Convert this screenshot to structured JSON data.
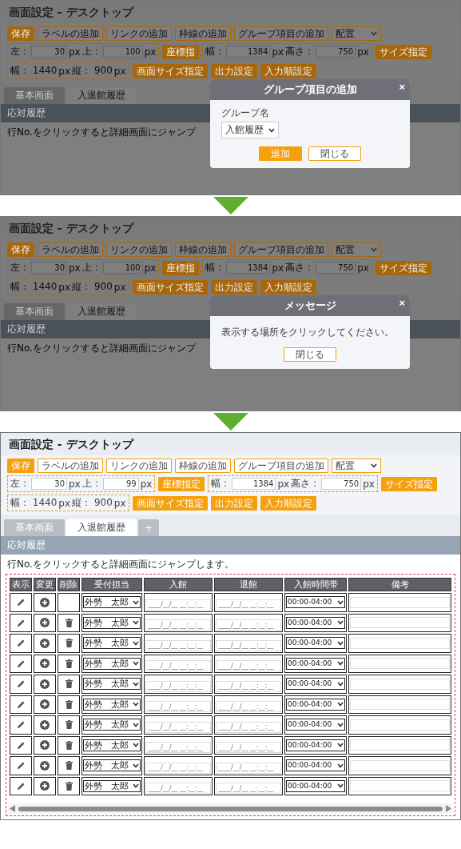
{
  "screens": [
    {
      "title": "画面設定 - デスクトップ",
      "toolbar": [
        {
          "kind": "filled",
          "label": "保存"
        },
        {
          "kind": "outline",
          "label": "ラベルの追加"
        },
        {
          "kind": "outline",
          "label": "リンクの追加"
        },
        {
          "kind": "outline",
          "label": "枠線の追加"
        },
        {
          "kind": "outline",
          "label": "グループ項目の追加"
        },
        {
          "kind": "select",
          "label": "配置"
        },
        {
          "kind": "fieldset",
          "parts": [
            {
              "kind": "text",
              "text": "左："
            },
            {
              "kind": "field",
              "text": "30"
            },
            {
              "kind": "text",
              "text": "px"
            },
            {
              "kind": "text",
              "text": "上："
            },
            {
              "kind": "field",
              "text": "100"
            },
            {
              "kind": "text",
              "text": "px"
            }
          ]
        },
        {
          "kind": "filled",
          "label": "座標指"
        },
        {
          "kind": "fieldset",
          "parts": [
            {
              "kind": "text",
              "text": "幅："
            },
            {
              "kind": "field",
              "text": "1384"
            },
            {
              "kind": "text",
              "text": "px"
            },
            {
              "kind": "text",
              "text": "高さ："
            },
            {
              "kind": "field",
              "text": "750"
            },
            {
              "kind": "text",
              "text": "px"
            }
          ]
        },
        {
          "kind": "filled",
          "label": "サイズ指定"
        },
        {
          "kind": "fieldset",
          "parts": [
            {
              "kind": "text",
              "text": "幅： 1440"
            },
            {
              "kind": "text",
              "text": "px"
            },
            {
              "kind": "text",
              "text": "縦： 900"
            },
            {
              "kind": "text",
              "text": "px"
            }
          ]
        },
        {
          "kind": "filled",
          "label": "画面サイズ指定"
        },
        {
          "kind": "filled",
          "label": "出力設定"
        },
        {
          "kind": "filled",
          "label": "入力順設定"
        }
      ],
      "tabs": [
        {
          "label": "基本画面",
          "selected": false
        },
        {
          "label": "入退館履歴",
          "selected": true
        }
      ],
      "section_title": "応対履歴",
      "hint": "行No.をクリックすると詳細画面にジャンプ",
      "dialog": {
        "title": "グループ項目の追加",
        "close": "×",
        "field_label": "グループ名",
        "select_value": "入館履歴",
        "buttons": [
          {
            "kind": "filled",
            "label": "追加"
          },
          {
            "kind": "outline",
            "label": "閉じる"
          }
        ]
      }
    },
    {
      "title": "画面設定 - デスクトップ",
      "toolbar": [
        {
          "kind": "filled",
          "label": "保存"
        },
        {
          "kind": "outline",
          "label": "ラベルの追加"
        },
        {
          "kind": "outline",
          "label": "リンクの追加"
        },
        {
          "kind": "outline",
          "label": "枠線の追加"
        },
        {
          "kind": "outline",
          "label": "グループ項目の追加"
        },
        {
          "kind": "select",
          "label": "配置"
        },
        {
          "kind": "fieldset",
          "parts": [
            {
              "kind": "text",
              "text": "左："
            },
            {
              "kind": "field",
              "text": "30"
            },
            {
              "kind": "text",
              "text": "px"
            },
            {
              "kind": "text",
              "text": "上："
            },
            {
              "kind": "field",
              "text": "100"
            },
            {
              "kind": "text",
              "text": "px"
            }
          ]
        },
        {
          "kind": "filled",
          "label": "座標指"
        },
        {
          "kind": "fieldset",
          "parts": [
            {
              "kind": "text",
              "text": "幅："
            },
            {
              "kind": "field",
              "text": "1384"
            },
            {
              "kind": "text",
              "text": "px"
            },
            {
              "kind": "text",
              "text": "高さ："
            },
            {
              "kind": "field",
              "text": "750"
            },
            {
              "kind": "text",
              "text": "px"
            }
          ]
        },
        {
          "kind": "filled",
          "label": "サイズ指定"
        },
        {
          "kind": "fieldset",
          "parts": [
            {
              "kind": "text",
              "text": "幅： 1440"
            },
            {
              "kind": "text",
              "text": "px"
            },
            {
              "kind": "text",
              "text": "縦： 900"
            },
            {
              "kind": "text",
              "text": "px"
            }
          ]
        },
        {
          "kind": "filled",
          "label": "画面サイズ指定"
        },
        {
          "kind": "filled",
          "label": "出力設定"
        },
        {
          "kind": "filled",
          "label": "入力順設定"
        }
      ],
      "tabs": [
        {
          "label": "基本画面",
          "selected": false
        },
        {
          "label": "入退館履歴",
          "selected": true
        }
      ],
      "section_title": "応対履歴",
      "hint": "行No.をクリックすると詳細画面にジャンプ",
      "dialog": {
        "title": "メッセージ",
        "close": "×",
        "message": "表示する場所をクリックしてください。",
        "buttons": [
          {
            "kind": "outline",
            "label": "閉じる"
          }
        ]
      }
    },
    {
      "title": "画面設定 - デスクトップ",
      "toolbar": [
        {
          "kind": "filled",
          "label": "保存"
        },
        {
          "kind": "outline",
          "label": "ラベルの追加"
        },
        {
          "kind": "outline",
          "label": "リンクの追加"
        },
        {
          "kind": "outline",
          "label": "枠線の追加"
        },
        {
          "kind": "outline",
          "label": "グループ項目の追加"
        },
        {
          "kind": "select",
          "label": "配置"
        },
        {
          "kind": "fieldset",
          "parts": [
            {
              "kind": "text",
              "text": "左："
            },
            {
              "kind": "field",
              "text": "30"
            },
            {
              "kind": "text",
              "text": "px"
            },
            {
              "kind": "text",
              "text": "上："
            },
            {
              "kind": "field",
              "text": "99"
            },
            {
              "kind": "text",
              "text": "px"
            }
          ]
        },
        {
          "kind": "filled",
          "label": "座標指定"
        },
        {
          "kind": "fieldset",
          "parts": [
            {
              "kind": "text",
              "text": "幅："
            },
            {
              "kind": "field",
              "text": "1384"
            },
            {
              "kind": "text",
              "text": "px"
            },
            {
              "kind": "text",
              "text": "高さ："
            },
            {
              "kind": "field",
              "text": "750"
            },
            {
              "kind": "text",
              "text": "px"
            }
          ]
        },
        {
          "kind": "filled",
          "label": "サイズ指定"
        },
        {
          "kind": "fieldset",
          "parts": [
            {
              "kind": "text",
              "text": "幅： 1440"
            },
            {
              "kind": "text",
              "text": "px"
            },
            {
              "kind": "text",
              "text": "縦： 900"
            },
            {
              "kind": "text",
              "text": "px"
            }
          ]
        },
        {
          "kind": "filled",
          "label": "画面サイズ指定"
        },
        {
          "kind": "filled",
          "label": "出力設定"
        },
        {
          "kind": "filled",
          "label": "入力順設定"
        }
      ],
      "tabs": [
        {
          "label": "基本画面",
          "selected": false
        },
        {
          "label": "入退館履歴",
          "selected": true
        }
      ],
      "add_tab": "+",
      "section_title": "応対履歴",
      "hint": "行No.をクリックすると詳細画面にジャンプします。",
      "table": {
        "columns": [
          "表示",
          "変更",
          "削除",
          "受付担当",
          "入館",
          "退館",
          "入館時間帯",
          "備考"
        ],
        "rows": [
          {
            "deletable": false,
            "staff": "外勢　太郎",
            "entry_placeholder": "____/__/__ __:__:__",
            "exit_placeholder": "____/__/__ __:__:__",
            "time_slot": "00:00-04:00"
          },
          {
            "deletable": true,
            "staff": "外勢　太郎",
            "entry_placeholder": "____/__/__ __:__:__",
            "exit_placeholder": "____/__/__ __:__:__",
            "time_slot": "00:00-04:00"
          },
          {
            "deletable": true,
            "staff": "外勢　太郎",
            "entry_placeholder": "____/__/__ __:__:__",
            "exit_placeholder": "____/__/__ __:__:__",
            "time_slot": "00:00-04:00"
          },
          {
            "deletable": true,
            "staff": "外勢　太郎",
            "entry_placeholder": "____/__/__ __:__:__",
            "exit_placeholder": "____/__/__ __:__:__",
            "time_slot": "00:00-04:00"
          },
          {
            "deletable": true,
            "staff": "外勢　太郎",
            "entry_placeholder": "____/__/__ __:__:__",
            "exit_placeholder": "____/__/__ __:__:__",
            "time_slot": "00:00-04:00"
          },
          {
            "deletable": true,
            "staff": "外勢　太郎",
            "entry_placeholder": "____/__/__ __:__:__",
            "exit_placeholder": "____/__/__ __:__:__",
            "time_slot": "00:00-04:00"
          },
          {
            "deletable": true,
            "staff": "外勢　太郎",
            "entry_placeholder": "____/__/__ __:__:__",
            "exit_placeholder": "____/__/__ __:__:__",
            "time_slot": "00:00-04:00"
          },
          {
            "deletable": true,
            "staff": "外勢　太郎",
            "entry_placeholder": "____/__/__ __:__:__",
            "exit_placeholder": "____/__/__ __:__:__",
            "time_slot": "00:00-04:00"
          },
          {
            "deletable": true,
            "staff": "外勢　太郎",
            "entry_placeholder": "____/__/__ __:__:__",
            "exit_placeholder": "____/__/__ __:__:__",
            "time_slot": "00:00-04:00"
          },
          {
            "deletable": true,
            "staff": "外勢　太郎",
            "entry_placeholder": "____/__/__ __:__:__",
            "exit_placeholder": "____/__/__ __:__:__",
            "time_slot": "00:00-04:00"
          }
        ]
      }
    }
  ]
}
